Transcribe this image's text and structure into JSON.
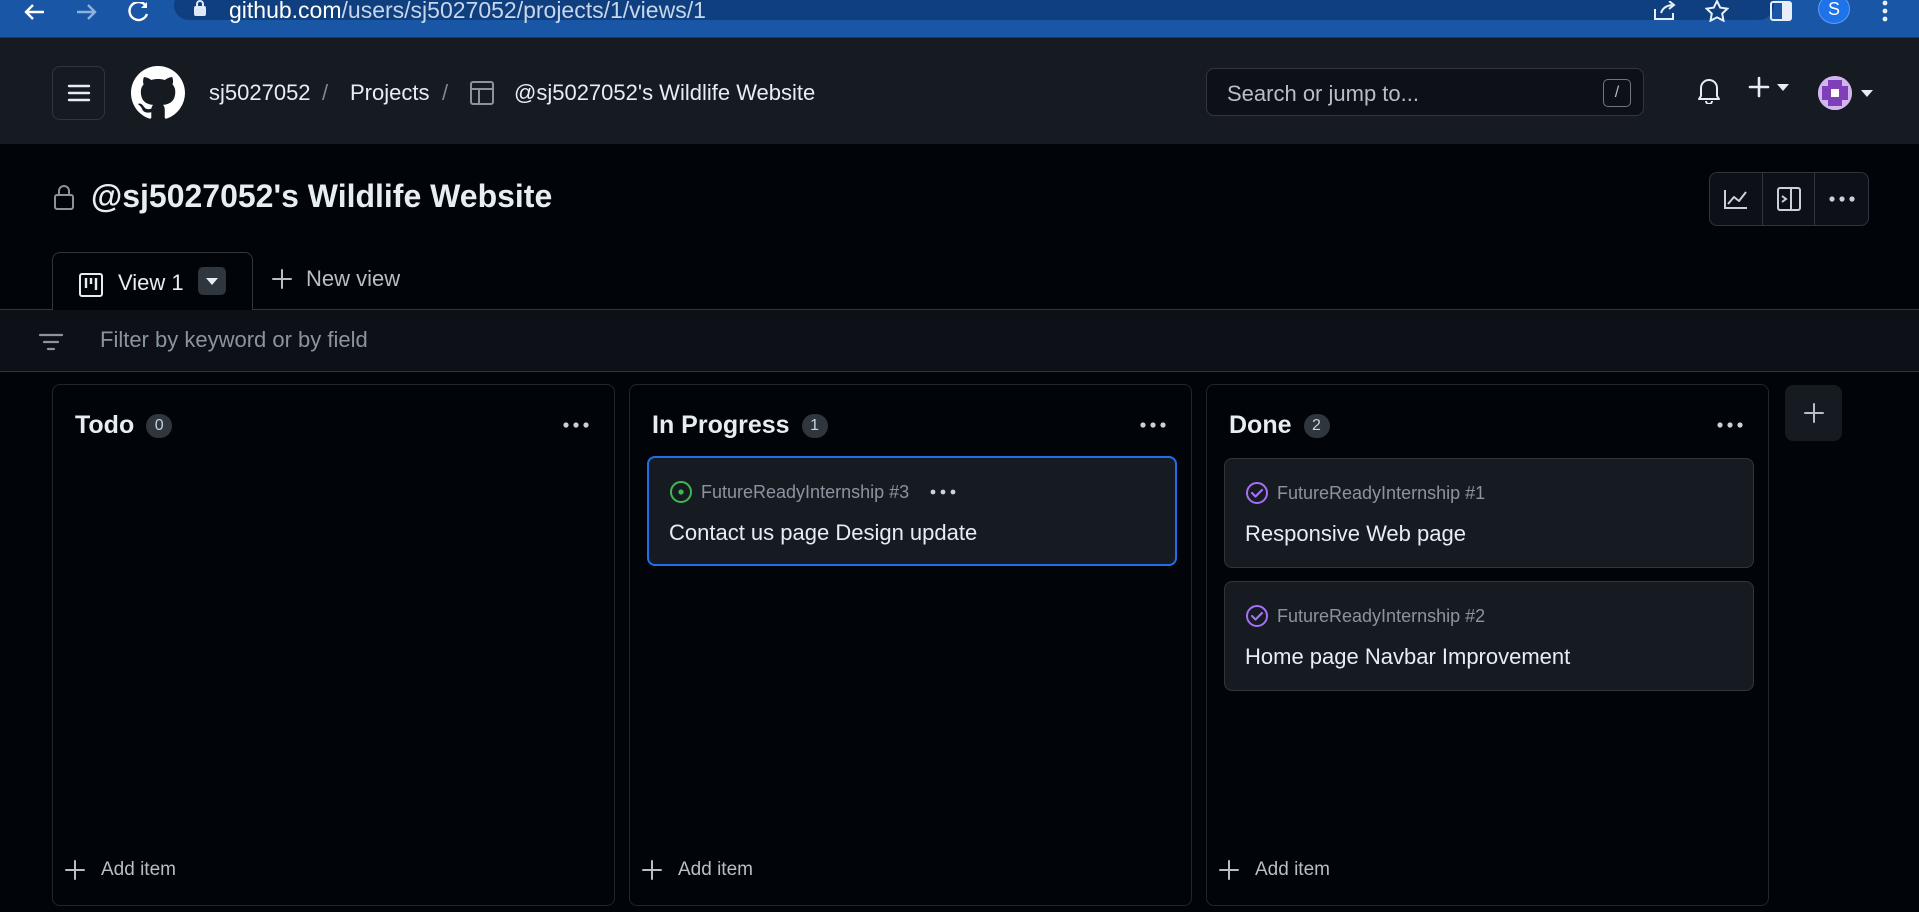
{
  "browser": {
    "url_host": "github.com",
    "url_path": "/users/sj5027052/projects/1/views/1",
    "profile_initial": "S"
  },
  "header": {
    "breadcrumbs": [
      "sj5027052",
      "Projects",
      "@sj5027052's Wildlife Website"
    ],
    "separator": "/",
    "search_placeholder": "Search or jump to...",
    "search_shortcut": "/"
  },
  "project": {
    "title": "@sj5027052's Wildlife Website"
  },
  "tabs": {
    "active_label": "View 1",
    "new_view_label": "New view"
  },
  "filter": {
    "placeholder": "Filter by keyword or by field"
  },
  "board": {
    "add_item_label": "Add item",
    "columns": [
      {
        "title": "Todo",
        "count": "0",
        "items": []
      },
      {
        "title": "In Progress",
        "count": "1",
        "items": [
          {
            "repo": "FutureReadyInternship #3",
            "title": "Contact us page Design update",
            "status": "open"
          }
        ]
      },
      {
        "title": "Done",
        "count": "2",
        "items": [
          {
            "repo": "FutureReadyInternship #1",
            "title": "Responsive Web page",
            "status": "closed"
          },
          {
            "repo": "FutureReadyInternship #2",
            "title": "Home page Navbar Improvement",
            "status": "closed"
          }
        ]
      }
    ]
  },
  "colors": {
    "open": "#3fb950",
    "closed": "#a371f7",
    "selected_border": "#1f6feb"
  }
}
